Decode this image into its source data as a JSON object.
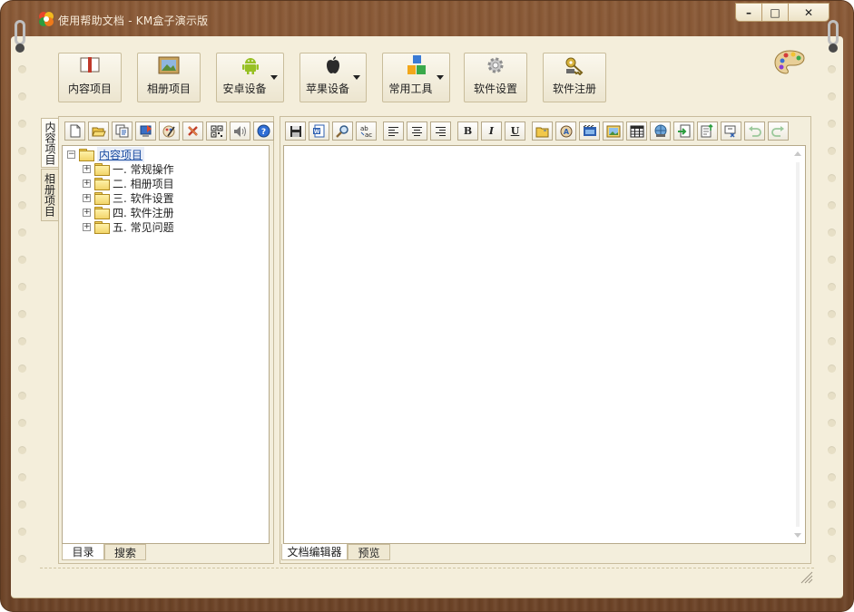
{
  "window": {
    "title": "使用帮助文档 - KM盒子演示版",
    "minimize": "–",
    "maximize": "□",
    "close": "✕"
  },
  "toolbar": [
    {
      "label": "内容项目",
      "icon": "book-icon",
      "dropdown": false
    },
    {
      "label": "相册项目",
      "icon": "picture-icon",
      "dropdown": false
    },
    {
      "label": "安卓设备",
      "icon": "android-icon",
      "dropdown": true
    },
    {
      "label": "苹果设备",
      "icon": "apple-icon",
      "dropdown": true
    },
    {
      "label": "常用工具",
      "icon": "blocks-icon",
      "dropdown": true
    },
    {
      "label": "软件设置",
      "icon": "gear-icon",
      "dropdown": false
    },
    {
      "label": "软件注册",
      "icon": "key-icon",
      "dropdown": false
    }
  ],
  "side_tabs": [
    "内容项目",
    "相册项目"
  ],
  "tree": {
    "root": "内容项目",
    "expander_open": "−",
    "expander_closed": "+",
    "children": [
      "一. 常规操作",
      "二. 相册项目",
      "三. 软件设置",
      "四. 软件注册",
      "五. 常见问题"
    ]
  },
  "left_bottom_tabs": [
    "目录",
    "搜索"
  ],
  "editor_bottom_tabs": [
    "文档编辑器",
    "预览"
  ],
  "left_tools": [
    "new-file-icon",
    "open-folder-icon",
    "copy-icon",
    "export-icon",
    "edit-icon",
    "delete-icon",
    "qr-icon",
    "sound-icon",
    "help-icon"
  ],
  "editor_tools": [
    "save-icon",
    "word-icon",
    "find-icon",
    "replace-icon",
    "align-left-icon",
    "align-center-icon",
    "align-right-icon",
    "bold-icon",
    "italic-icon",
    "underline-icon",
    "insert-folder-icon",
    "font-color-icon",
    "video-icon",
    "image-icon",
    "table-icon",
    "web-icon",
    "import-icon",
    "export-doc-icon",
    "clear-format-icon",
    "undo-icon",
    "redo-icon"
  ],
  "editor_glyphs": {
    "bold": "B",
    "italic": "I",
    "underline": "U",
    "replace": "ab"
  },
  "colors": {
    "wood": "#7a4d2e",
    "paper": "#f4eedb",
    "link": "#1d4ea2"
  }
}
